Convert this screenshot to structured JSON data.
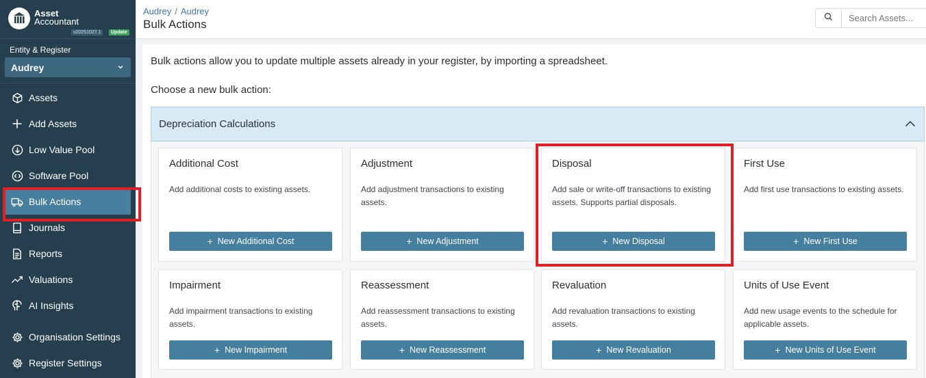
{
  "brand": {
    "name_line1": "Asset",
    "name_line2": "Accountant",
    "version": "v20251027.1",
    "update_label": "Update"
  },
  "sidebar": {
    "entity_label": "Entity & Register",
    "entity_value": "Audrey",
    "items": [
      {
        "label": "Assets",
        "icon": "cube-icon"
      },
      {
        "label": "Add Assets",
        "icon": "plus-icon"
      },
      {
        "label": "Low Value Pool",
        "icon": "arrow-down-circle-icon"
      },
      {
        "label": "Software Pool",
        "icon": "code-circle-icon"
      },
      {
        "label": "Bulk Actions",
        "icon": "truck-icon"
      },
      {
        "label": "Journals",
        "icon": "book-icon"
      },
      {
        "label": "Reports",
        "icon": "document-icon"
      },
      {
        "label": "Valuations",
        "icon": "trend-up-icon"
      },
      {
        "label": "AI Insights",
        "icon": "brain-icon"
      },
      {
        "label": "Organisation Settings",
        "icon": "gear-icon"
      },
      {
        "label": "Register Settings",
        "icon": "gear-icon"
      }
    ]
  },
  "header": {
    "breadcrumb": [
      "Audrey",
      "Audrey"
    ],
    "title": "Bulk Actions",
    "search_placeholder": "Search Assets..."
  },
  "main": {
    "intro": "Bulk actions allow you to update multiple assets already in your register, by importing a spreadsheet.",
    "choose": "Choose a new bulk action:",
    "section_title": "Depreciation Calculations",
    "cards": [
      {
        "title": "Additional Cost",
        "description": "Add additional costs to existing assets.",
        "button": "New Additional Cost"
      },
      {
        "title": "Adjustment",
        "description": "Add adjustment transactions to existing assets.",
        "button": "New Adjustment"
      },
      {
        "title": "Disposal",
        "description": "Add sale or write-off transactions to existing assets. Supports partial disposals.",
        "button": "New Disposal"
      },
      {
        "title": "First Use",
        "description": "Add first use transactions to existing assets.",
        "button": "New First Use"
      },
      {
        "title": "Impairment",
        "description": "Add impairment transactions to existing assets.",
        "button": "New Impairment"
      },
      {
        "title": "Reassessment",
        "description": "Add reassessment transactions to existing assets.",
        "button": "New Reassessment"
      },
      {
        "title": "Revaluation",
        "description": "Add revaluation transactions to existing assets.",
        "button": "New Revaluation"
      },
      {
        "title": "Units of Use Event",
        "description": "Add new usage events to the schedule for applicable assets.",
        "button": "New Units of Use Event"
      }
    ]
  },
  "colors": {
    "sidebar_bg": "#263f4f",
    "accent": "#457fa0",
    "highlight": "#e01f26",
    "section_bg": "#d7eaf5"
  }
}
